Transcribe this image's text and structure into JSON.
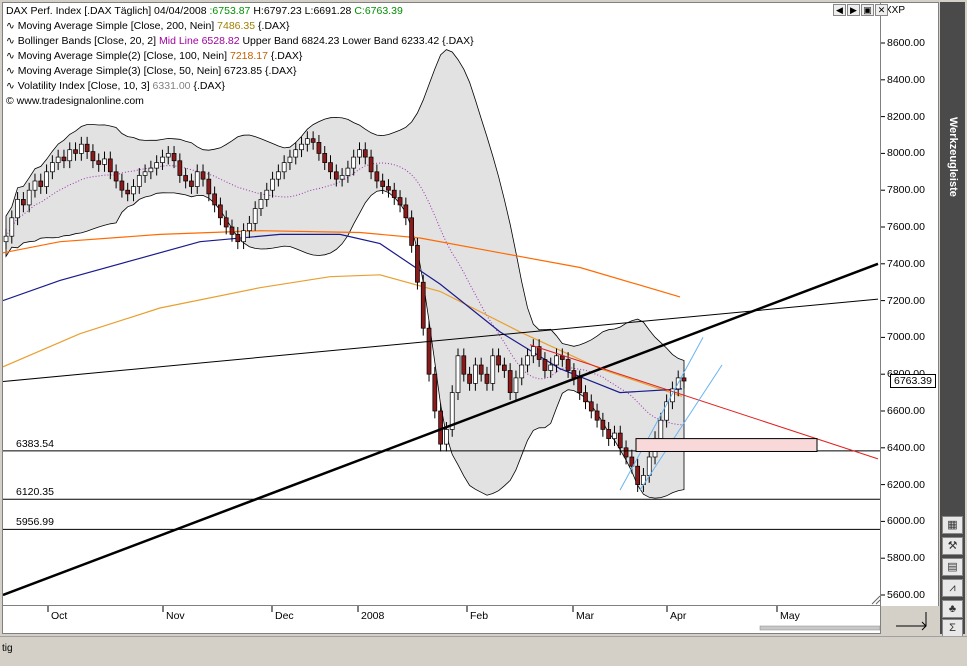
{
  "window": {
    "legend": {
      "title": "DAX Perf. Index [.DAX  Täglich] 04/04/2008",
      "open": ":6753.87",
      "hlc": " H:6797.23 L:6691.28",
      "close": "C:6763.39",
      "ind1_name": "Moving Average Simple [Close, 200, Nein]",
      "ind1_val": "7486.35",
      "ind1_sym": "{.DAX}",
      "ind2_name": "Bollinger Bands [Close, 20, 2]",
      "ind2_mid": "Mid Line 6528.82",
      "ind2_bands": "Upper Band 6824.23 Lower Band 6233.42",
      "ind2_sym": "{.DAX}",
      "ind3_name": "Moving Average Simple(2) [Close, 100, Nein]",
      "ind3_val": "7218.17",
      "ind3_sym": "{.DAX}",
      "ind4_name": "Moving Average Simple(3) [Close, 50, Nein]",
      "ind4_val": "6723.85",
      "ind4_sym": "{.DAX}",
      "ind5_name": "Volatility Index [Close, 10, 3]",
      "ind5_val": "6331.00",
      "ind5_sym": "{.DAX}",
      "source": "www.tradesignalonline.com"
    },
    "xxp": "XXP",
    "toolbar_title": "Werkzeugleiste",
    "status": "tig"
  },
  "colors": {
    "candle_up": "#ffffff",
    "candle_down": "#8b1a1a",
    "ma200": "#ff6a00",
    "ma100": "#e8a030",
    "ma50": "#1a1a8c",
    "boll_fill": "#d8d8d8",
    "boll_mid": "#9b30b0",
    "trend_red": "#e02020",
    "channel_blue": "#6ab4f0",
    "support_box": "#f8d8d8"
  },
  "chart_data": {
    "type": "candlestick",
    "title": "DAX Perf. Index [.DAX  Täglich] 04/04/2008",
    "ylim": [
      5500,
      8750
    ],
    "y_ticks": [
      "8600.00",
      "8400.00",
      "8200.00",
      "8000.00",
      "7800.00",
      "7600.00",
      "7400.00",
      "7200.00",
      "7000.00",
      "6800.00",
      "6600.00",
      "6400.00",
      "6200.00",
      "6000.00",
      "5800.00",
      "5600.00"
    ],
    "y_tick_values": [
      8600,
      8400,
      8200,
      8000,
      7800,
      7600,
      7400,
      7200,
      7000,
      6800,
      6600,
      6400,
      6200,
      6000,
      5800,
      5600
    ],
    "x_ticks": [
      "Oct",
      "Nov",
      "Dec",
      "2008",
      "Feb",
      "Mar",
      "Apr",
      "May"
    ],
    "last_price": "6763.39",
    "horizontal_levels": [
      {
        "label": "6383.54",
        "value": 6383.54
      },
      {
        "label": "6120.35",
        "value": 6120.35
      },
      {
        "label": "5956.99",
        "value": 5956.99
      }
    ],
    "closes": [
      7550,
      7650,
      7750,
      7720,
      7800,
      7850,
      7820,
      7900,
      7950,
      7980,
      7960,
      8020,
      8000,
      8050,
      8010,
      7960,
      7940,
      7970,
      7900,
      7850,
      7800,
      7780,
      7820,
      7880,
      7900,
      7920,
      7950,
      7980,
      8000,
      7960,
      7880,
      7850,
      7820,
      7900,
      7860,
      7780,
      7720,
      7650,
      7600,
      7560,
      7520,
      7580,
      7620,
      7700,
      7750,
      7800,
      7860,
      7900,
      7950,
      7980,
      8020,
      8050,
      8080,
      8060,
      8000,
      7950,
      7900,
      7860,
      7880,
      7920,
      7980,
      8020,
      7980,
      7900,
      7850,
      7820,
      7800,
      7760,
      7720,
      7650,
      7500,
      7300,
      7050,
      6800,
      6600,
      6420,
      6500,
      6700,
      6900,
      6800,
      6750,
      6850,
      6800,
      6750,
      6900,
      6850,
      6820,
      6700,
      6780,
      6850,
      6900,
      6950,
      6880,
      6820,
      6850,
      6900,
      6880,
      6820,
      6780,
      6700,
      6650,
      6600,
      6550,
      6500,
      6450,
      6480,
      6400,
      6350,
      6300,
      6200,
      6250,
      6350,
      6450,
      6550,
      6650,
      6720,
      6780,
      6763
    ]
  }
}
